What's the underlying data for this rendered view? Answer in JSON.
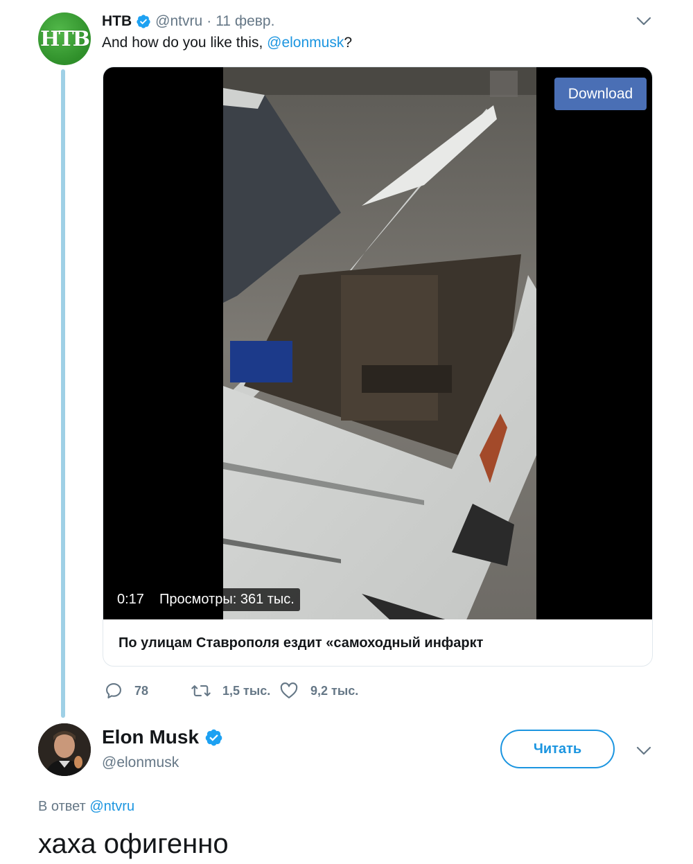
{
  "tweet1": {
    "author_name": "НТВ",
    "author_handle": "@ntvru",
    "separator": "·",
    "date": "11 февр.",
    "text_before": "And how do you like this, ",
    "text_mention": "@elonmusk",
    "text_after": "?",
    "avatar_logo": "НТВ",
    "card": {
      "download_label": "Download",
      "duration": "0:17",
      "views": "Просмотры: 361 тыс.",
      "title": "По улицам Ставрополя ездит «самоходный инфаркт"
    },
    "actions": {
      "replies": "78",
      "retweets": "1,5 тыс.",
      "likes": "9,2 тыс."
    }
  },
  "tweet2": {
    "author_name": "Elon Musk",
    "author_handle": "@elonmusk",
    "follow_label": "Читать",
    "reply_prefix": "В ответ ",
    "reply_mention": "@ntvru",
    "text": "хаха офигенно"
  },
  "colors": {
    "link": "#1b95e0",
    "secondary": "#657786",
    "thread_line": "#9fd0e6",
    "download_button": "#4a6fb5"
  },
  "icons": [
    "verified-badge-icon",
    "chevron-down-icon",
    "reply-icon",
    "retweet-icon",
    "like-icon"
  ]
}
